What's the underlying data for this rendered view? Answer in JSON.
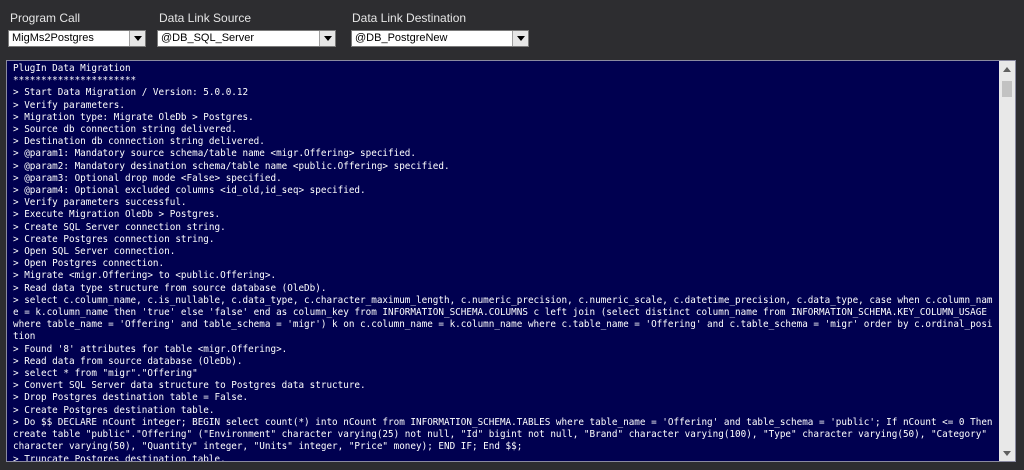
{
  "toolbar": {
    "program_call": {
      "label": "Program Call",
      "value": "MigMs2Postgres"
    },
    "data_link_source": {
      "label": "Data Link Source",
      "value": "@DB_SQL_Server"
    },
    "data_link_destination": {
      "label": "Data Link Destination",
      "value": "@DB_PostgreNew"
    }
  },
  "console": {
    "lines": [
      "PlugIn Data Migration",
      "**********************",
      "> Start Data Migration / Version: 5.0.0.12",
      "> Verify parameters.",
      "> Migration type: Migrate OleDb > Postgres.",
      "> Source db connection string delivered.",
      "> Destination db connection string delivered.",
      "> @param1: Mandatory source schema/table name <migr.Offering> specified.",
      "> @param2: Mandatory desination schema/table name <public.Offering> specified.",
      "> @param3: Optional drop mode <False> specified.",
      "> @param4: Optional excluded columns <id_old,id_seq> specified.",
      "> Verify parameters successful.",
      "> Execute Migration OleDb > Postgres.",
      "> Create SQL Server connection string.",
      "> Create Postgres connection string.",
      "> Open SQL Server connection.",
      "> Open Postgres connection.",
      "> Migrate <migr.Offering> to <public.Offering>.",
      "> Read data type structure from source database (OleDb).",
      "> select c.column_name, c.is_nullable, c.data_type, c.character_maximum_length, c.numeric_precision, c.numeric_scale, c.datetime_precision, c.data_type, case when c.column_name = k.column_name then 'true' else 'false' end as column_key from INFORMATION_SCHEMA.COLUMNS c left join (select distinct column_name from INFORMATION_SCHEMA.KEY_COLUMN_USAGE where table_name = 'Offering' and table_schema = 'migr') k on c.column_name = k.column_name where c.table_name = 'Offering' and c.table_schema = 'migr' order by c.ordinal_position",
      "> Found '8' attributes for table <migr.Offering>.",
      "> Read data from source database (OleDb).",
      "> select * from \"migr\".\"Offering\"",
      "> Convert SQL Server data structure to Postgres data structure.",
      "> Drop Postgres destination table = False.",
      "> Create Postgres destination table.",
      "> Do $$ DECLARE nCount integer; BEGIN select count(*) into nCount from INFORMATION_SCHEMA.TABLES where table_name = 'Offering' and table_schema = 'public'; If nCount <= 0 Then create table \"public\".\"Offering\" (\"Environment\" character varying(25) not null, \"Id\" bigint not null, \"Brand\" character varying(100), \"Type\" character varying(50), \"Category\" character varying(50), \"Quantity\" integer, \"Units\" integer, \"Price\" money); END IF; End $$;",
      "> Truncate Postgres destination table."
    ]
  },
  "colors": {
    "background": "#2d2d30",
    "console_background": "#000050",
    "console_text": "#ffffff"
  }
}
